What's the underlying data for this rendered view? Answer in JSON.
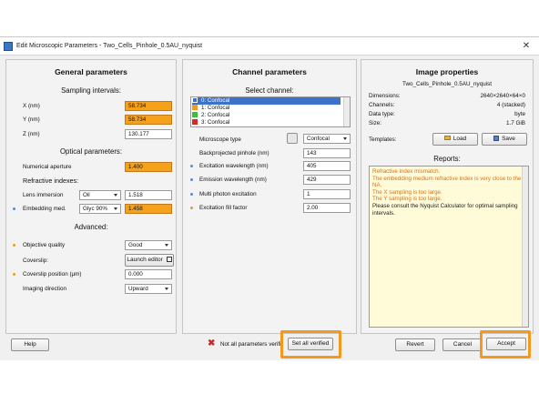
{
  "window": {
    "title": "Edit Microscopic Parameters - Two_Cells_Pinhole_0.5AU_nyquist",
    "close_glyph": "✕"
  },
  "colors": {
    "highlight": "#f39a1e",
    "warning_field": "#f5a11a",
    "report_warning_text": "#d8711a",
    "report_bg": "#fffbd8"
  },
  "general": {
    "title": "General parameters",
    "sampling_header": "Sampling intervals:",
    "x_label": "X (nm)",
    "x_value": "58.734",
    "y_label": "Y (nm)",
    "y_value": "58.734",
    "z_label": "Z (nm)",
    "z_value": "130.177",
    "optical_header": "Optical parameters:",
    "na_label": "Numerical aperture",
    "na_value": "1.400",
    "refractive_header": "Refractive indexes:",
    "lens_label": "Lens immersion",
    "lens_select": "Oil",
    "lens_value": "1.518",
    "embed_label": "Embedding med.",
    "embed_select": "Glyc 90%",
    "embed_value": "1.458",
    "advanced_header": "Advanced:",
    "objq_label": "Objective quality",
    "objq_value": "Good",
    "coverslip_label": "Coverslip:",
    "launch_editor": "Launch editor",
    "coverpos_label": "Coverslip position (µm)",
    "coverpos_value": "0.000",
    "imaging_label": "Imaging direction",
    "imaging_value": "Upward"
  },
  "channel": {
    "title": "Channel parameters",
    "select_header": "Select channel:",
    "channels": [
      {
        "label": "0: Confocal",
        "color": "#3c72c9",
        "selected": true
      },
      {
        "label": "1: Confocal",
        "color": "#f39a1e",
        "selected": false
      },
      {
        "label": "2: Confocal",
        "color": "#3bbf3b",
        "selected": false
      },
      {
        "label": "3: Confocal",
        "color": "#d42a2a",
        "selected": false
      }
    ],
    "mtype_label": "Microscope type",
    "mtype_value": "Confocal",
    "pinhole_label": "Backprojected pinhole (nm)",
    "pinhole_value": "143",
    "exc_label": "Excitation wavelength (nm)",
    "exc_value": "405",
    "em_label": "Emission wavelength (nm)",
    "em_value": "429",
    "multi_label": "Multi photon excitation",
    "multi_value": "1",
    "fill_label": "Excitation fill factor",
    "fill_value": "2.00"
  },
  "image": {
    "title": "Image properties",
    "filename": "Two_Cells_Pinhole_0.5AU_nyquist",
    "dims_label": "Dimensions:",
    "dims_value": "2640×2640×64×0",
    "channels_label": "Channels:",
    "channels_value": "4 (stacked)",
    "dtype_label": "Data type:",
    "dtype_value": "byte",
    "size_label": "Size:",
    "size_value": "1.7 GiB",
    "templates_label": "Templates:",
    "load_label": "Load",
    "save_label": "Save",
    "reports_header": "Reports:",
    "reports": [
      {
        "text": "Refractive index mismatch.",
        "kind": "warn"
      },
      {
        "text": "The embedding medium refractive index is very close to the",
        "kind": "warn"
      },
      {
        "text": "NA.",
        "kind": "warn"
      },
      {
        "text": "The X sampling is too large.",
        "kind": "warn"
      },
      {
        "text": "The Y sampling is too large.",
        "kind": "warn"
      },
      {
        "text": "Please consult the Nyquist Calculator for optimal sampling",
        "kind": "info"
      },
      {
        "text": "intervals.",
        "kind": "info"
      }
    ]
  },
  "footer": {
    "help": "Help",
    "status_text": "Not all parameters verifi",
    "set_all_verified": "Set all verified",
    "revert": "Revert",
    "cancel": "Cancel",
    "accept": "Accept"
  }
}
